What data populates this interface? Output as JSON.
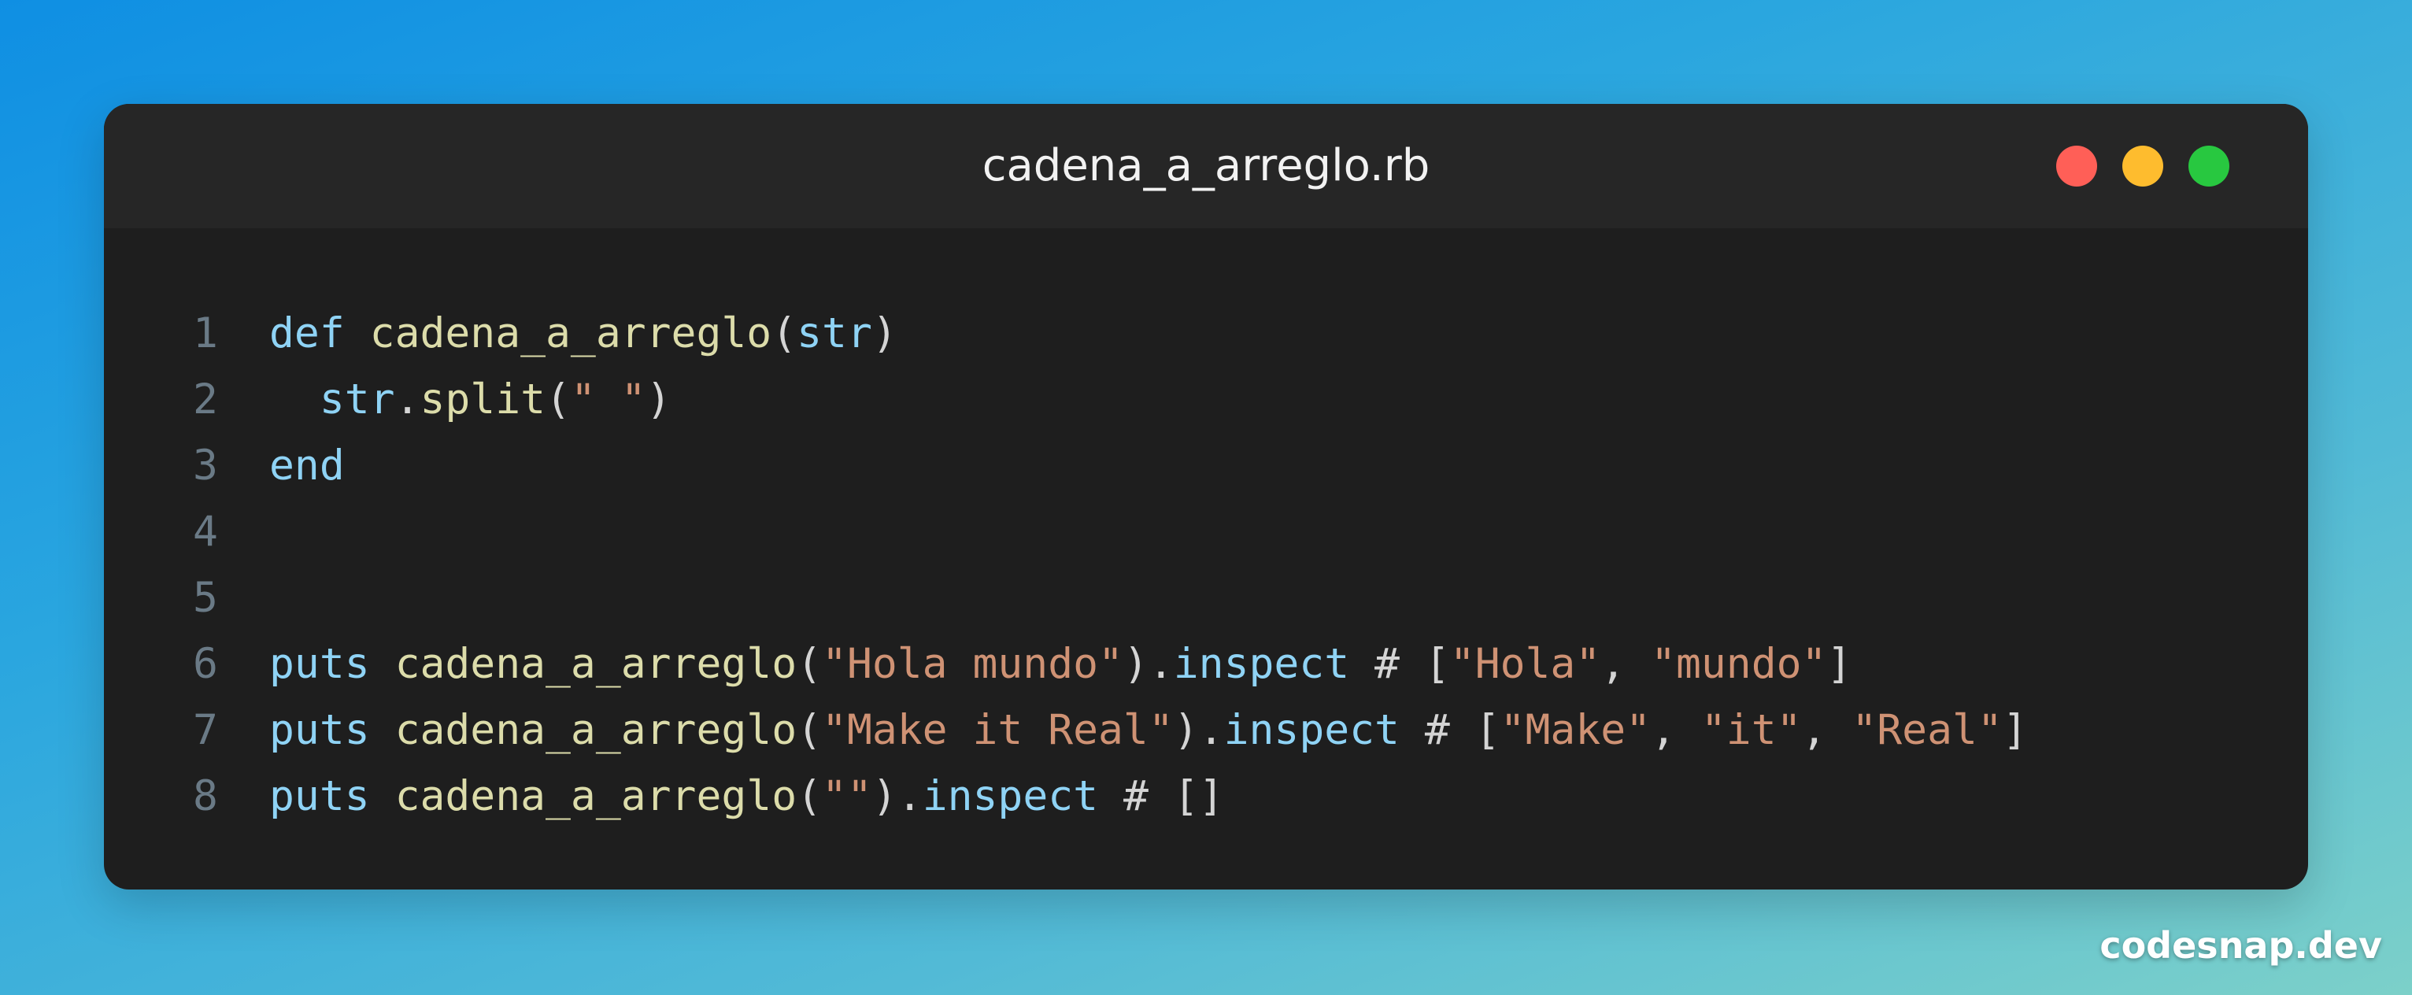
{
  "window": {
    "title": "cadena_a_arreglo.rb",
    "controls": [
      {
        "name": "close",
        "color": "#ff5f57"
      },
      {
        "name": "minimize",
        "color": "#febc2e"
      },
      {
        "name": "maximize",
        "color": "#28c840"
      }
    ]
  },
  "colors": {
    "keyword": "#8fd3f5",
    "function": "#dcdcaa",
    "string": "#cf9274",
    "plain": "#d4d4d4",
    "line_number": "#6a7a86"
  },
  "code": {
    "language": "ruby",
    "lines": [
      {
        "number": "1",
        "tokens": [
          {
            "t": "kw",
            "v": "def"
          },
          {
            "t": "pl",
            "v": " "
          },
          {
            "t": "fn",
            "v": "cadena_a_arreglo"
          },
          {
            "t": "pl",
            "v": "("
          },
          {
            "t": "kw",
            "v": "str"
          },
          {
            "t": "pl",
            "v": ")"
          }
        ]
      },
      {
        "number": "2",
        "tokens": [
          {
            "t": "pl",
            "v": "  "
          },
          {
            "t": "kw",
            "v": "str"
          },
          {
            "t": "pl",
            "v": "."
          },
          {
            "t": "fn",
            "v": "split"
          },
          {
            "t": "pl",
            "v": "("
          },
          {
            "t": "str",
            "v": "\" \""
          },
          {
            "t": "pl",
            "v": ")"
          }
        ]
      },
      {
        "number": "3",
        "tokens": [
          {
            "t": "kw",
            "v": "end"
          }
        ]
      },
      {
        "number": "4",
        "tokens": []
      },
      {
        "number": "5",
        "tokens": []
      },
      {
        "number": "6",
        "tokens": [
          {
            "t": "kw",
            "v": "puts"
          },
          {
            "t": "pl",
            "v": " "
          },
          {
            "t": "fn",
            "v": "cadena_a_arreglo"
          },
          {
            "t": "pl",
            "v": "("
          },
          {
            "t": "str",
            "v": "\"Hola mundo\""
          },
          {
            "t": "pl",
            "v": ")."
          },
          {
            "t": "kw",
            "v": "inspect"
          },
          {
            "t": "pl",
            "v": " # ["
          },
          {
            "t": "str",
            "v": "\"Hola\""
          },
          {
            "t": "pl",
            "v": ", "
          },
          {
            "t": "str",
            "v": "\"mundo\""
          },
          {
            "t": "pl",
            "v": "]"
          }
        ]
      },
      {
        "number": "7",
        "tokens": [
          {
            "t": "kw",
            "v": "puts"
          },
          {
            "t": "pl",
            "v": " "
          },
          {
            "t": "fn",
            "v": "cadena_a_arreglo"
          },
          {
            "t": "pl",
            "v": "("
          },
          {
            "t": "str",
            "v": "\"Make it Real\""
          },
          {
            "t": "pl",
            "v": ")."
          },
          {
            "t": "kw",
            "v": "inspect"
          },
          {
            "t": "pl",
            "v": " # ["
          },
          {
            "t": "str",
            "v": "\"Make\""
          },
          {
            "t": "pl",
            "v": ", "
          },
          {
            "t": "str",
            "v": "\"it\""
          },
          {
            "t": "pl",
            "v": ", "
          },
          {
            "t": "str",
            "v": "\"Real\""
          },
          {
            "t": "pl",
            "v": "]"
          }
        ]
      },
      {
        "number": "8",
        "tokens": [
          {
            "t": "kw",
            "v": "puts"
          },
          {
            "t": "pl",
            "v": " "
          },
          {
            "t": "fn",
            "v": "cadena_a_arreglo"
          },
          {
            "t": "pl",
            "v": "("
          },
          {
            "t": "str",
            "v": "\"\""
          },
          {
            "t": "pl",
            "v": ")."
          },
          {
            "t": "kw",
            "v": "inspect"
          },
          {
            "t": "pl",
            "v": " # []"
          }
        ]
      }
    ]
  },
  "watermark": "codesnap.dev"
}
